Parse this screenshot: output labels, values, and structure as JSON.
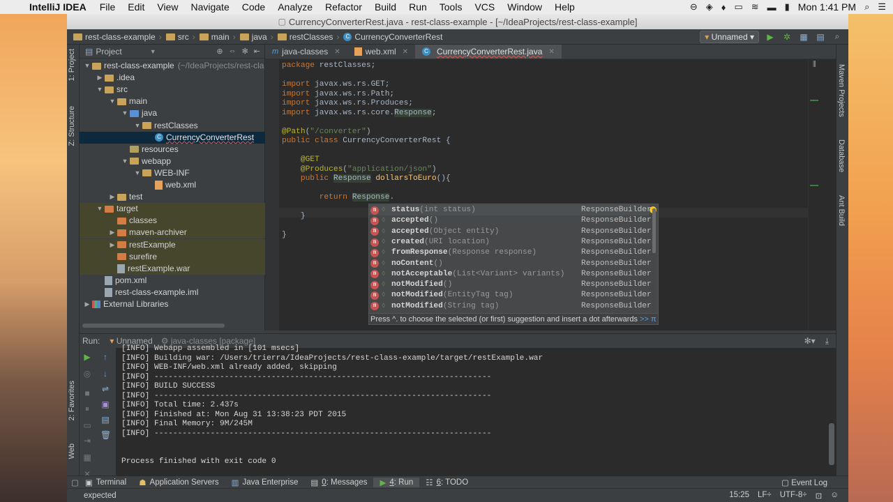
{
  "menubar": {
    "app_name": "IntelliJ IDEA",
    "items": [
      "File",
      "Edit",
      "View",
      "Navigate",
      "Code",
      "Analyze",
      "Refactor",
      "Build",
      "Run",
      "Tools",
      "VCS",
      "Window",
      "Help"
    ],
    "clock": "Mon 1:41 PM"
  },
  "window": {
    "title": "CurrencyConverterRest.java - rest-class-example - [~/IdeaProjects/rest-class-example]"
  },
  "navbar": {
    "crumbs": [
      "rest-class-example",
      "src",
      "main",
      "java",
      "restClasses",
      "CurrencyConverterRest"
    ],
    "run_config": "Unnamed"
  },
  "left_strip": {
    "project_tab": "1: Project",
    "structure_tab": "Z: Structure",
    "favorites_tab": "2: Favorites",
    "web_tab": "Web"
  },
  "right_strip": {
    "maven_tab": "Maven Projects",
    "database_tab": "Database",
    "ant_tab": "Ant Build"
  },
  "project": {
    "header": "Project",
    "tree": [
      {
        "label": "rest-class-example",
        "extra": "(~/IdeaProjects/rest-cla",
        "depth": 0,
        "arrow": "▼",
        "icon": "folder"
      },
      {
        "label": ".idea",
        "depth": 1,
        "arrow": "▶",
        "icon": "folder"
      },
      {
        "label": "src",
        "depth": 1,
        "arrow": "▼",
        "icon": "folder"
      },
      {
        "label": "main",
        "depth": 2,
        "arrow": "▼",
        "icon": "folder"
      },
      {
        "label": "java",
        "depth": 3,
        "arrow": "▼",
        "icon": "src"
      },
      {
        "label": "restClasses",
        "depth": 4,
        "arrow": "▼",
        "icon": "folder"
      },
      {
        "label": "CurrencyConverterRest",
        "depth": 5,
        "arrow": "",
        "icon": "class",
        "selected": true
      },
      {
        "label": "resources",
        "depth": 3,
        "arrow": "",
        "icon": "res"
      },
      {
        "label": "webapp",
        "depth": 3,
        "arrow": "▼",
        "icon": "folder"
      },
      {
        "label": "WEB-INF",
        "depth": 4,
        "arrow": "▼",
        "icon": "folder"
      },
      {
        "label": "web.xml",
        "depth": 5,
        "arrow": "",
        "icon": "xml"
      },
      {
        "label": "test",
        "depth": 2,
        "arrow": "▶",
        "icon": "folder"
      },
      {
        "label": "target",
        "depth": 1,
        "arrow": "▼",
        "icon": "target",
        "hl": true
      },
      {
        "label": "classes",
        "depth": 2,
        "arrow": "",
        "icon": "target",
        "hl": true
      },
      {
        "label": "maven-archiver",
        "depth": 2,
        "arrow": "▶",
        "icon": "target",
        "hl": true
      },
      {
        "label": "restExample",
        "depth": 2,
        "arrow": "▶",
        "icon": "target",
        "hl": true
      },
      {
        "label": "surefire",
        "depth": 2,
        "arrow": "",
        "icon": "target",
        "hl": true
      },
      {
        "label": "restExample.war",
        "depth": 2,
        "arrow": "",
        "icon": "file",
        "hl": true
      },
      {
        "label": "pom.xml",
        "depth": 1,
        "arrow": "",
        "icon": "file"
      },
      {
        "label": "rest-class-example.iml",
        "depth": 1,
        "arrow": "",
        "icon": "file"
      },
      {
        "label": "External Libraries",
        "depth": 0,
        "arrow": "▶",
        "icon": "lib"
      }
    ]
  },
  "editor": {
    "tabs": [
      {
        "label": "java-classes",
        "icon": "m"
      },
      {
        "label": "web.xml",
        "icon": "xml"
      },
      {
        "label": "CurrencyConverterRest.java",
        "icon": "class",
        "active": true
      }
    ]
  },
  "completion": {
    "items": [
      {
        "name": "status",
        "params": "(int status)",
        "type": "ResponseBuilder"
      },
      {
        "name": "accepted",
        "params": "()",
        "type": "ResponseBuilder"
      },
      {
        "name": "accepted",
        "params": "(Object entity)",
        "type": "ResponseBuilder"
      },
      {
        "name": "created",
        "params": "(URI location)",
        "type": "ResponseBuilder"
      },
      {
        "name": "fromResponse",
        "params": "(Response response)",
        "type": "ResponseBuilder"
      },
      {
        "name": "noContent",
        "params": "()",
        "type": "ResponseBuilder"
      },
      {
        "name": "notAcceptable",
        "params": "(List<Variant> variants)",
        "type": "ResponseBuilder"
      },
      {
        "name": "notModified",
        "params": "()",
        "type": "ResponseBuilder"
      },
      {
        "name": "notModified",
        "params": "(EntityTag tag)",
        "type": "ResponseBuilder"
      },
      {
        "name": "notModified",
        "params": "(String tag)",
        "type": "ResponseBuilder"
      }
    ],
    "hint": "Press ^. to choose the selected (or first) suggestion and insert a dot afterwards",
    "hint_link": ">>"
  },
  "run": {
    "label": "Run:",
    "tab": "Unnamed",
    "sub": "java-classes [package]",
    "console": [
      "[INFO] Webapp assembled in [101 msecs]",
      "[INFO] Building war: /Users/trierra/IdeaProjects/rest-class-example/target/restExample.war",
      "[INFO] WEB-INF/web.xml already added, skipping",
      "[INFO] ------------------------------------------------------------------------",
      "[INFO] BUILD SUCCESS",
      "[INFO] ------------------------------------------------------------------------",
      "[INFO] Total time: 2.437s",
      "[INFO] Finished at: Mon Aug 31 13:38:23 PDT 2015",
      "[INFO] Final Memory: 9M/245M",
      "[INFO] ------------------------------------------------------------------------",
      "",
      "Process finished with exit code 0"
    ]
  },
  "bottom_tabs": {
    "terminal": "Terminal",
    "app_servers": "Application Servers",
    "java_ee": "Java Enterprise",
    "messages_num": "0",
    "messages": ": Messages",
    "run_num": "4",
    "run": ": Run",
    "todo_num": "6",
    "todo": ": TODO",
    "event_log": "Event Log"
  },
  "status": {
    "message": "expected",
    "position": "15:25",
    "line_sep": "LF÷",
    "encoding": "UTF-8÷"
  }
}
